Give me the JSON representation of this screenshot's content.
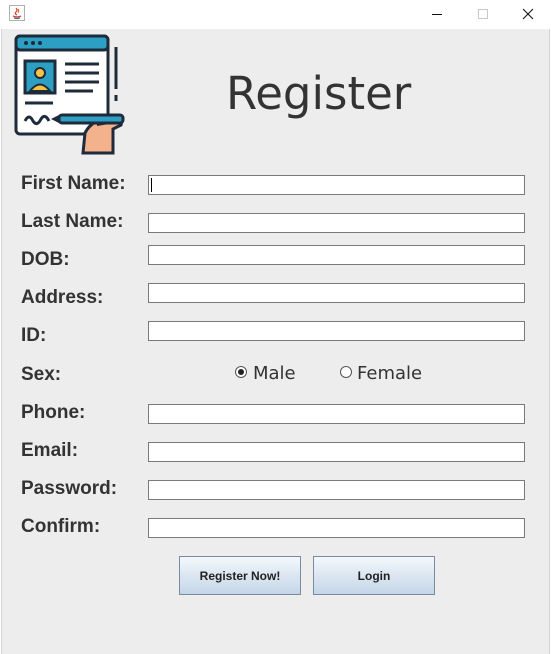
{
  "window": {
    "controls": {
      "minimize_icon": "minimize-icon",
      "maximize_icon": "maximize-icon",
      "close_icon": "close-icon"
    }
  },
  "form": {
    "title": "Register",
    "logo_icon": "registration-document-icon",
    "fields": {
      "first_name": {
        "label": "First Name:",
        "value": ""
      },
      "last_name": {
        "label": "Last Name:",
        "value": ""
      },
      "dob": {
        "label": "DOB:",
        "value": ""
      },
      "address": {
        "label": "Address:",
        "value": ""
      },
      "id": {
        "label": "ID:",
        "value": ""
      },
      "phone": {
        "label": "Phone:",
        "value": ""
      },
      "email": {
        "label": "Email:",
        "value": ""
      },
      "password": {
        "label": "Password:",
        "value": ""
      },
      "confirm": {
        "label": "Confirm:",
        "value": ""
      }
    },
    "sex": {
      "label": "Sex:",
      "options": [
        "Male",
        "Female"
      ],
      "selected": "Male"
    },
    "buttons": {
      "register": "Register Now!",
      "login": "Login"
    }
  },
  "colors": {
    "background": "#ededed",
    "text": "#333333",
    "field_border": "#7a7a7a",
    "button_gradient_top": "#f4f8fc",
    "button_gradient_bottom": "#c6d6e7"
  }
}
